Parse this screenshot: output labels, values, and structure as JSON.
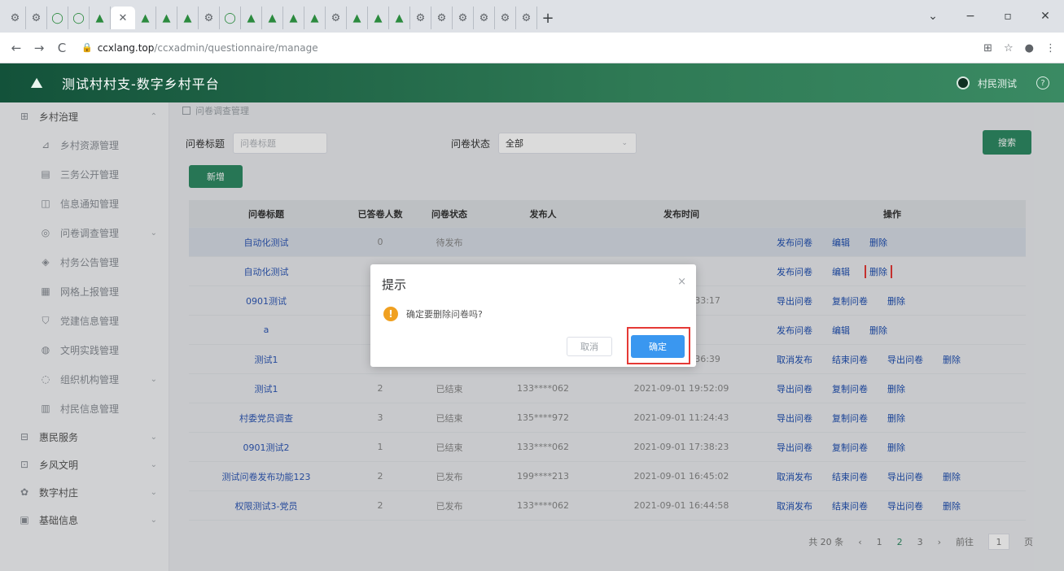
{
  "browser": {
    "tabs": [
      {
        "glyph": "⚙",
        "kind": "gray"
      },
      {
        "glyph": "⚙",
        "kind": "gray"
      },
      {
        "glyph": "◯",
        "kind": "green"
      },
      {
        "glyph": "◯",
        "kind": "green"
      },
      {
        "glyph": "▲",
        "kind": "green"
      },
      {
        "glyph": "✕",
        "kind": "active"
      },
      {
        "glyph": "▲",
        "kind": "green"
      },
      {
        "glyph": "▲",
        "kind": "green"
      },
      {
        "glyph": "▲",
        "kind": "green"
      },
      {
        "glyph": "⚙",
        "kind": "gray"
      },
      {
        "glyph": "◯",
        "kind": "green"
      },
      {
        "glyph": "▲",
        "kind": "green"
      },
      {
        "glyph": "▲",
        "kind": "green"
      },
      {
        "glyph": "▲",
        "kind": "green"
      },
      {
        "glyph": "▲",
        "kind": "green"
      },
      {
        "glyph": "⚙",
        "kind": "gray"
      },
      {
        "glyph": "▲",
        "kind": "green"
      },
      {
        "glyph": "▲",
        "kind": "green"
      },
      {
        "glyph": "▲",
        "kind": "green"
      },
      {
        "glyph": "⚙",
        "kind": "gray"
      },
      {
        "glyph": "⚙",
        "kind": "gray"
      },
      {
        "glyph": "⚙",
        "kind": "gray"
      },
      {
        "glyph": "⚙",
        "kind": "gray"
      },
      {
        "glyph": "⚙",
        "kind": "gray"
      },
      {
        "glyph": "⚙",
        "kind": "gray"
      }
    ],
    "new_tab": "+",
    "minimize": "−",
    "restore": "▫",
    "close": "✕",
    "dropdown": "⌄",
    "back": "←",
    "forward": "→",
    "reload": "C",
    "lock": "🔒",
    "url_host": "ccxlang.top",
    "url_path": "/ccxadmin/questionnaire/manage",
    "ext_icon": "⊞",
    "star_icon": "☆",
    "profile_icon": "●",
    "menu_icon": "⋮"
  },
  "app": {
    "title": "测试村村支-数字乡村平台",
    "logo": "⛰",
    "user_name": "村民测试",
    "help": "?"
  },
  "sidebar": {
    "items": [
      {
        "label": "乡村治理",
        "icon": "⊞",
        "sub": false,
        "chev": "⌃"
      },
      {
        "label": "乡村资源管理",
        "icon": "⊿",
        "sub": true,
        "chev": ""
      },
      {
        "label": "三务公开管理",
        "icon": "▤",
        "sub": true,
        "chev": ""
      },
      {
        "label": "信息通知管理",
        "icon": "◫",
        "sub": true,
        "chev": ""
      },
      {
        "label": "问卷调查管理",
        "icon": "◎",
        "sub": true,
        "chev": "⌄"
      },
      {
        "label": "村务公告管理",
        "icon": "◈",
        "sub": true,
        "chev": ""
      },
      {
        "label": "网格上报管理",
        "icon": "▦",
        "sub": true,
        "chev": ""
      },
      {
        "label": "党建信息管理",
        "icon": "⛉",
        "sub": true,
        "chev": ""
      },
      {
        "label": "文明实践管理",
        "icon": "◍",
        "sub": true,
        "chev": ""
      },
      {
        "label": "组织机构管理",
        "icon": "◌",
        "sub": true,
        "chev": "⌄"
      },
      {
        "label": "村民信息管理",
        "icon": "▥",
        "sub": true,
        "chev": ""
      },
      {
        "label": "惠民服务",
        "icon": "⊟",
        "sub": false,
        "chev": "⌄"
      },
      {
        "label": "乡风文明",
        "icon": "⊡",
        "sub": false,
        "chev": "⌄"
      },
      {
        "label": "数字村庄",
        "icon": "✿",
        "sub": false,
        "chev": "⌄"
      },
      {
        "label": "基础信息",
        "icon": "▣",
        "sub": false,
        "chev": "⌄"
      }
    ]
  },
  "main": {
    "breadcrumb": "问卷调查管理",
    "filter_title_label": "问卷标题",
    "filter_title_placeholder": "问卷标题",
    "filter_status_label": "问卷状态",
    "filter_status_value": "全部",
    "search_button": "搜索",
    "add_button": "新增",
    "columns": [
      "问卷标题",
      "已答卷人数",
      "问卷状态",
      "发布人",
      "发布时间",
      "操作"
    ],
    "rows": [
      {
        "title": "自动化测试",
        "count": "0",
        "status": "待发布",
        "publisher": "",
        "time": "",
        "ops": [
          "发布问卷",
          "编辑",
          "删除"
        ],
        "highlight": true
      },
      {
        "title": "自动化测试",
        "count": "",
        "status": "",
        "publisher": "",
        "time": "",
        "ops": [
          "发布问卷",
          "编辑",
          "删除"
        ],
        "highlight": false,
        "ops_highlight": 2
      },
      {
        "title": "0901测试",
        "count": "",
        "status": "",
        "publisher": "",
        "time": "1-09-01 16:33:17",
        "ops": [
          "导出问卷",
          "复制问卷",
          "删除"
        ],
        "highlight": false
      },
      {
        "title": "a",
        "count": "",
        "status": "",
        "publisher": "",
        "time": "",
        "ops": [
          "发布问卷",
          "编辑",
          "删除"
        ],
        "highlight": false
      },
      {
        "title": "测试1",
        "count": "",
        "status": "",
        "publisher": "",
        "time": "1-10-08 14:36:39",
        "ops": [
          "取消发布",
          "结束问卷",
          "导出问卷",
          "删除"
        ],
        "highlight": false
      },
      {
        "title": "测试1",
        "count": "2",
        "status": "已结束",
        "publisher": "133****062",
        "time": "2021-09-01 19:52:09",
        "ops": [
          "导出问卷",
          "复制问卷",
          "删除"
        ],
        "highlight": false
      },
      {
        "title": "村委党员调查",
        "count": "3",
        "status": "已结束",
        "publisher": "135****972",
        "time": "2021-09-01 11:24:43",
        "ops": [
          "导出问卷",
          "复制问卷",
          "删除"
        ],
        "highlight": false
      },
      {
        "title": "0901测试2",
        "count": "1",
        "status": "已结束",
        "publisher": "133****062",
        "time": "2021-09-01 17:38:23",
        "ops": [
          "导出问卷",
          "复制问卷",
          "删除"
        ],
        "highlight": false
      },
      {
        "title": "测试问卷发布功能123",
        "count": "2",
        "status": "已发布",
        "publisher": "199****213",
        "time": "2021-09-01 16:45:02",
        "ops": [
          "取消发布",
          "结束问卷",
          "导出问卷",
          "删除"
        ],
        "highlight": false
      },
      {
        "title": "权限测试3-党员",
        "count": "2",
        "status": "已发布",
        "publisher": "133****062",
        "time": "2021-09-01 16:44:58",
        "ops": [
          "取消发布",
          "结束问卷",
          "导出问卷",
          "删除"
        ],
        "highlight": false
      }
    ],
    "pager": {
      "total": "共 20 条",
      "prev": "‹",
      "pages": [
        "1",
        "2",
        "3"
      ],
      "active_page": "2",
      "next": "›",
      "goto_label": "前往",
      "goto_value": "1",
      "goto_suffix": "页"
    }
  },
  "dialog": {
    "title": "提示",
    "close": "×",
    "warn": "!",
    "message": "确定要删除问卷吗?",
    "cancel": "取消",
    "confirm": "确定"
  }
}
